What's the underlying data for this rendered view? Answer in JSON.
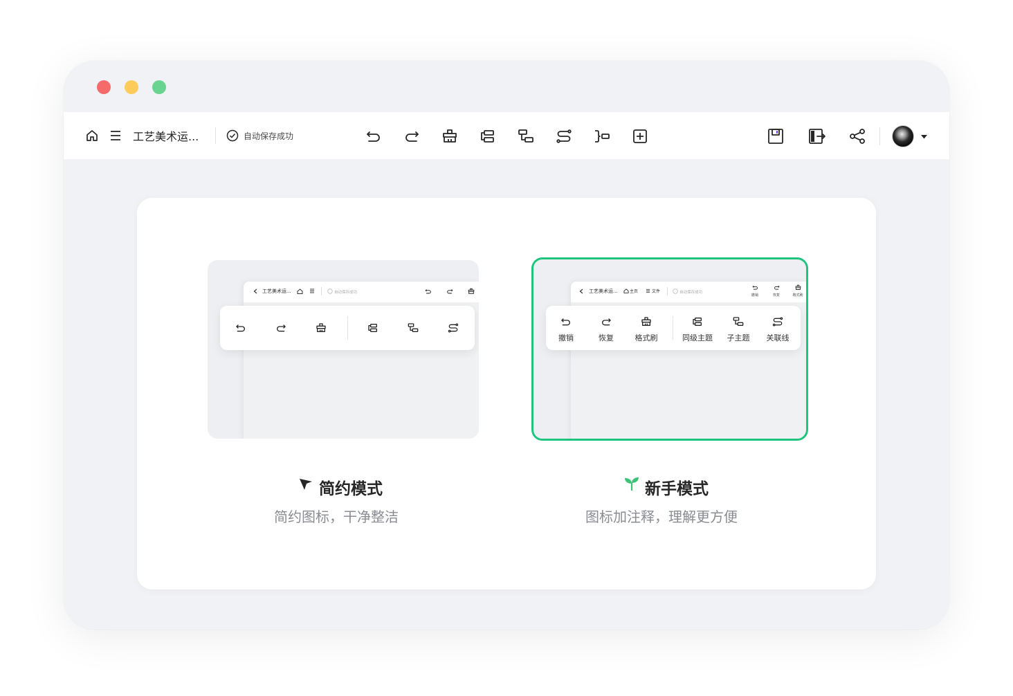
{
  "topbar": {
    "doc_title": "工艺美术运...",
    "autosave_text": "自动保存成功",
    "icons": [
      "home-icon",
      "menu-icon",
      "check-circle-icon",
      "undo-icon",
      "redo-icon",
      "format-brush-icon",
      "sibling-topic-icon",
      "child-topic-icon",
      "relation-line-icon",
      "summary-icon",
      "add-box-icon",
      "save-icon",
      "exit-icon",
      "share-icon",
      "caret-down-icon"
    ]
  },
  "simple_mode": {
    "title": "简约模式",
    "description": "简约图标，干净整洁",
    "preview": {
      "doc_title": "工艺美术运...",
      "autosave_text": "自动保存成功"
    }
  },
  "novice_mode": {
    "title": "新手模式",
    "description": "图标加注释，理解更方便",
    "selected": true,
    "accent_color": "#20c47f",
    "preview": {
      "doc_title": "工艺美术运...",
      "home_label": "主页",
      "file_label": "文件",
      "autosave_text": "自动保存成功",
      "mini_tools": [
        "撤销",
        "恢复",
        "格式刷"
      ],
      "tools": [
        "撤销",
        "恢复",
        "格式刷",
        "同级主题",
        "子主题",
        "关联线"
      ]
    }
  },
  "colors": {
    "window_bg": "#f1f2f5",
    "traffic_red": "#f56b6b",
    "traffic_yellow": "#fccb5a",
    "traffic_green": "#69d48f",
    "selected_border": "#20c47f"
  }
}
